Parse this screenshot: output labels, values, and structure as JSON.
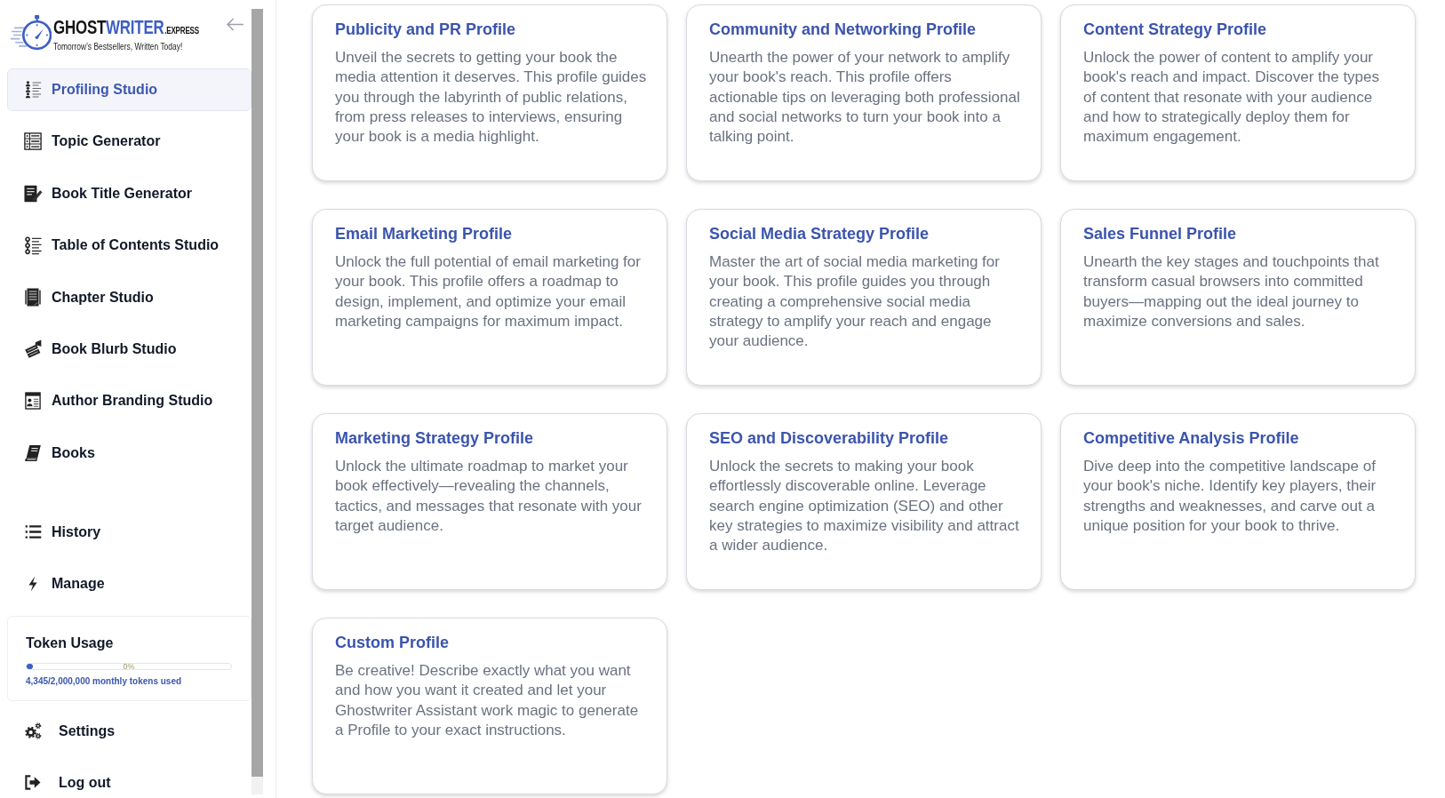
{
  "sidebar": {
    "logo": {
      "name_parts": [
        "GHOST",
        "WRITER",
        ".EXPRESS"
      ],
      "tagline": "Tomorrow's Bestsellers, Written Today!"
    },
    "nav_items": [
      {
        "label": "Profiling Studio",
        "selected": true
      },
      {
        "label": "Topic Generator",
        "selected": false
      },
      {
        "label": "Book Title Generator",
        "selected": false
      },
      {
        "label": "Table of Contents Studio",
        "selected": false
      },
      {
        "label": "Chapter Studio",
        "selected": false
      },
      {
        "label": "Book Blurb Studio",
        "selected": false
      },
      {
        "label": "Author Branding Studio",
        "selected": false
      },
      {
        "label": "Books",
        "selected": false
      }
    ],
    "utility_items": [
      {
        "label": "History",
        "selected": false
      },
      {
        "label": "Manage",
        "selected": false
      }
    ],
    "token_usage": {
      "title": "Token Usage",
      "percent": "0%",
      "level": 0.03,
      "summary": "4,345/2,000,000 monthly tokens used"
    },
    "account_items": [
      {
        "label": "Settings",
        "selected": false
      },
      {
        "label": "Log out",
        "selected": false
      }
    ]
  },
  "profiles": [
    {
      "title": "Publicity and PR Profile",
      "description": "Unveil the secrets to getting your book the media attention it deserves. This profile guides you through the labyrinth of public relations, from press releases to interviews, ensuring your book is a media highlight."
    },
    {
      "title": "Community and Networking Profile",
      "description": "Unearth the power of your network to amplify your book's reach. This profile offers actionable tips on leveraging both professional and social networks to turn your book into a talking point."
    },
    {
      "title": "Content Strategy Profile",
      "description": "Unlock the power of content to amplify your book's reach and impact. Discover the types of content that resonate with your audience and how to strategically deploy them for maximum engagement."
    },
    {
      "title": "Email Marketing Profile",
      "description": "Unlock the full potential of email marketing for your book. This profile offers a roadmap to design, implement, and optimize your email marketing campaigns for maximum impact."
    },
    {
      "title": "Social Media Strategy Profile",
      "description": "Master the art of social media marketing for your book. This profile guides you through creating a comprehensive social media strategy to amplify your reach and engage your audience."
    },
    {
      "title": "Sales Funnel Profile",
      "description": "Unearth the key stages and touchpoints that transform casual browsers into committed buyers—mapping out the ideal journey to maximize conversions and sales."
    },
    {
      "title": "Marketing Strategy Profile",
      "description": "Unlock the ultimate roadmap to market your book effectively—revealing the channels, tactics, and messages that resonate with your target audience."
    },
    {
      "title": "SEO and Discoverability Profile",
      "description": "Unlock the secrets to making your book effortlessly discoverable online. Leverage search engine optimization (SEO) and other key strategies to maximize visibility and attract a wider audience."
    },
    {
      "title": "Competitive Analysis Profile",
      "description": "Dive deep into the competitive landscape of your book's niche. Identify key players, their strengths and weaknesses, and carve out a unique position for your book to thrive."
    },
    {
      "title": "Custom Profile",
      "description": "Be creative! Describe exactly what you want and how you want it created and let your Ghostwriter Assistant work magic to generate a Profile to your exact instructions."
    }
  ]
}
